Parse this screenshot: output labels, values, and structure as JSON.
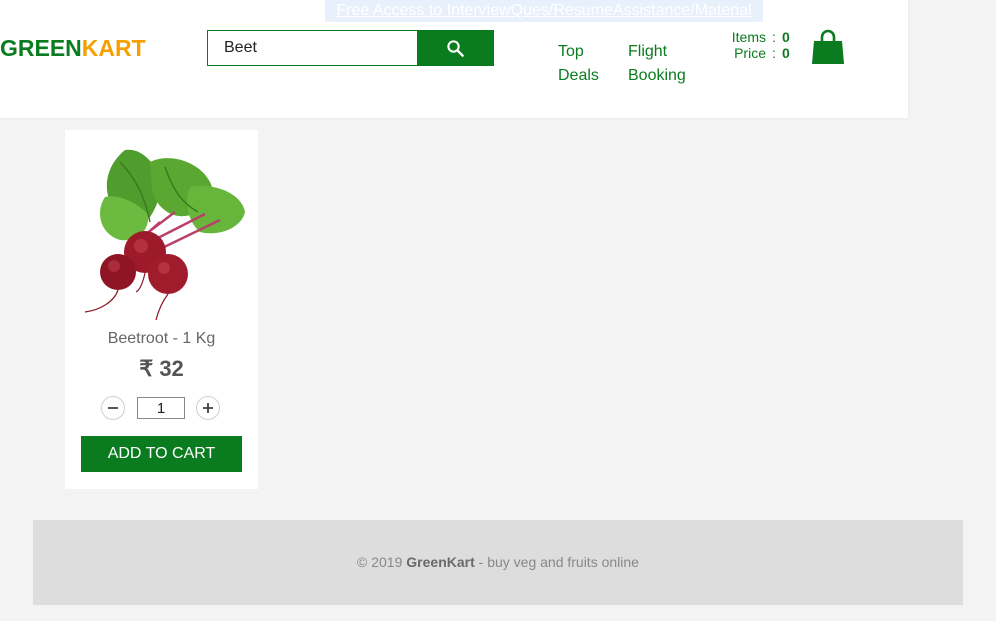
{
  "promo": {
    "text": "Free Access to InterviewQues/ResumeAssistance/Material"
  },
  "brand": {
    "part1": "GREEN",
    "part2": "KART",
    "color1": "#0a7c1f",
    "color2": "#f6a000"
  },
  "search": {
    "value": "Beet",
    "button_icon": "search-icon"
  },
  "nav": {
    "top_deals": "Top Deals",
    "flight_booking": "Flight Booking"
  },
  "cart": {
    "items_label": "Items",
    "items_value": "0",
    "price_label": "Price",
    "price_value": "0",
    "separator": ":",
    "icon": "shopping-bag-icon"
  },
  "product": {
    "name": "Beetroot - 1 Kg",
    "price": "₹ 32",
    "quantity": "1",
    "decrement_icon": "minus-icon",
    "increment_icon": "plus-icon",
    "add_to_cart_label": "ADD TO CART"
  },
  "footer": {
    "prefix": "© 2019 ",
    "brand": "GreenKart",
    "suffix": " - buy veg and fruits online"
  },
  "colors": {
    "accent": "#0a7c1f",
    "brand_orange": "#f6a000",
    "footer_bg": "#dddddd"
  }
}
